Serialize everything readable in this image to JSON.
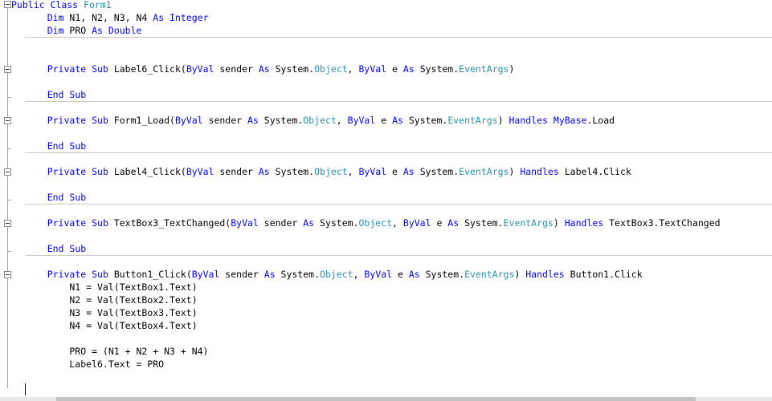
{
  "colors": {
    "keyword": "#0000ff",
    "type": "#2b91af",
    "text": "#000000",
    "separator": "#c8c8c8"
  },
  "icons": {
    "fold": "collapse-minus-icon"
  },
  "code": {
    "line1": {
      "a": "Public",
      "b": " ",
      "c": "Class",
      "d": " ",
      "e": "Form1"
    },
    "line2": {
      "a": "    ",
      "b": "Dim",
      "c": " N1, N2, N3, N4 ",
      "d": "As",
      "e": " ",
      "f": "Integer"
    },
    "line3": {
      "a": "    ",
      "b": "Dim",
      "c": " PRO ",
      "d": "As",
      "e": " ",
      "f": "Double"
    },
    "sub1": {
      "decl": [
        "    ",
        "Private",
        " ",
        "Sub",
        " Label6_Click(",
        "ByVal",
        " sender ",
        "As",
        " System.",
        "Object",
        ", ",
        "ByVal",
        " e ",
        "As",
        " System.",
        "EventArgs",
        ")"
      ],
      "end": [
        "    ",
        "End",
        " ",
        "Sub"
      ]
    },
    "sub2": {
      "decl": [
        "    ",
        "Private",
        " ",
        "Sub",
        " Form1_Load(",
        "ByVal",
        " sender ",
        "As",
        " System.",
        "Object",
        ", ",
        "ByVal",
        " e ",
        "As",
        " System.",
        "EventArgs",
        ") ",
        "Handles",
        " ",
        "MyBase",
        ".Load"
      ],
      "end": [
        "    ",
        "End",
        " ",
        "Sub"
      ]
    },
    "sub3": {
      "decl": [
        "    ",
        "Private",
        " ",
        "Sub",
        " Label4_Click(",
        "ByVal",
        " sender ",
        "As",
        " System.",
        "Object",
        ", ",
        "ByVal",
        " e ",
        "As",
        " System.",
        "EventArgs",
        ") ",
        "Handles",
        " Label4.Click"
      ],
      "end": [
        "    ",
        "End",
        " ",
        "Sub"
      ]
    },
    "sub4": {
      "decl": [
        "    ",
        "Private",
        " ",
        "Sub",
        " TextBox3_TextChanged(",
        "ByVal",
        " sender ",
        "As",
        " System.",
        "Object",
        ", ",
        "ByVal",
        " e ",
        "As",
        " System.",
        "EventArgs",
        ") ",
        "Handles",
        " TextBox3.TextChanged"
      ],
      "end": [
        "    ",
        "End",
        " ",
        "Sub"
      ]
    },
    "sub5": {
      "decl": [
        "    ",
        "Private",
        " ",
        "Sub",
        " Button1_Click(",
        "ByVal",
        " sender ",
        "As",
        " System.",
        "Object",
        ", ",
        "ByVal",
        " e ",
        "As",
        " System.",
        "EventArgs",
        ") ",
        "Handles",
        " Button1.Click"
      ],
      "body": [
        "        N1 = Val(TextBox1.Text)",
        "        N2 = Val(TextBox2.Text)",
        "        N3 = Val(TextBox3.Text)",
        "        N4 = Val(TextBox4.Text)",
        "",
        "        PRO = (N1 + N2 + N3 + N4)",
        "        Label6.Text = PRO"
      ]
    }
  }
}
